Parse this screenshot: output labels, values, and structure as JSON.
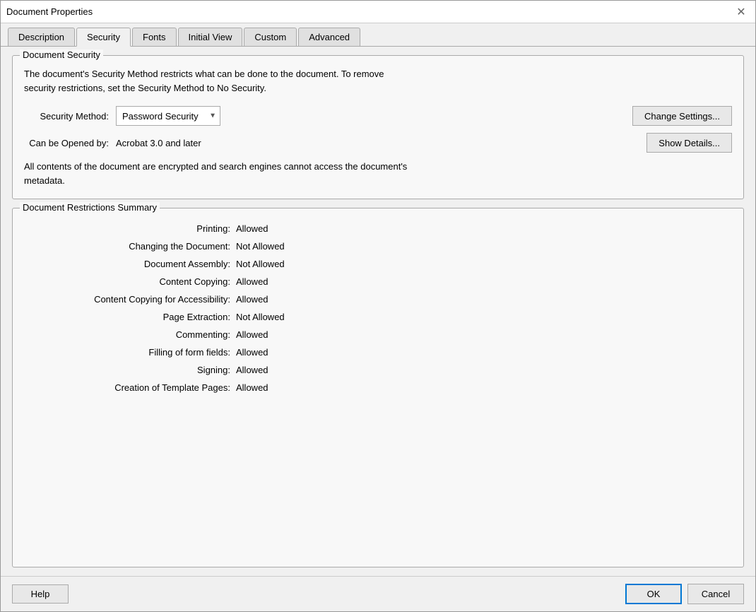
{
  "window": {
    "title": "Document Properties",
    "close_label": "✕"
  },
  "tabs": [
    {
      "id": "description",
      "label": "Description",
      "active": false
    },
    {
      "id": "security",
      "label": "Security",
      "active": true
    },
    {
      "id": "fonts",
      "label": "Fonts",
      "active": false
    },
    {
      "id": "initial_view",
      "label": "Initial View",
      "active": false
    },
    {
      "id": "custom",
      "label": "Custom",
      "active": false
    },
    {
      "id": "advanced",
      "label": "Advanced",
      "active": false
    }
  ],
  "document_security": {
    "group_title": "Document Security",
    "description": "The document's Security Method restricts what can be done to the document. To remove\nsecurity restrictions, set the Security Method to No Security.",
    "security_method_label": "Security Method:",
    "security_method_value": "Password Security",
    "change_settings_label": "Change Settings...",
    "opened_by_label": "Can be Opened by:",
    "opened_by_value": "Acrobat 3.0 and later",
    "show_details_label": "Show Details...",
    "encryption_note": "All contents of the document are encrypted and search engines cannot access the document's\nmetadata."
  },
  "document_restrictions": {
    "group_title": "Document Restrictions Summary",
    "items": [
      {
        "label": "Printing:",
        "value": "Allowed"
      },
      {
        "label": "Changing the Document:",
        "value": "Not Allowed"
      },
      {
        "label": "Document Assembly:",
        "value": "Not Allowed"
      },
      {
        "label": "Content Copying:",
        "value": "Allowed"
      },
      {
        "label": "Content Copying for Accessibility:",
        "value": "Allowed"
      },
      {
        "label": "Page Extraction:",
        "value": "Not Allowed"
      },
      {
        "label": "Commenting:",
        "value": "Allowed"
      },
      {
        "label": "Filling of form fields:",
        "value": "Allowed"
      },
      {
        "label": "Signing:",
        "value": "Allowed"
      },
      {
        "label": "Creation of Template Pages:",
        "value": "Allowed"
      }
    ]
  },
  "footer": {
    "help_label": "Help",
    "ok_label": "OK",
    "cancel_label": "Cancel"
  }
}
